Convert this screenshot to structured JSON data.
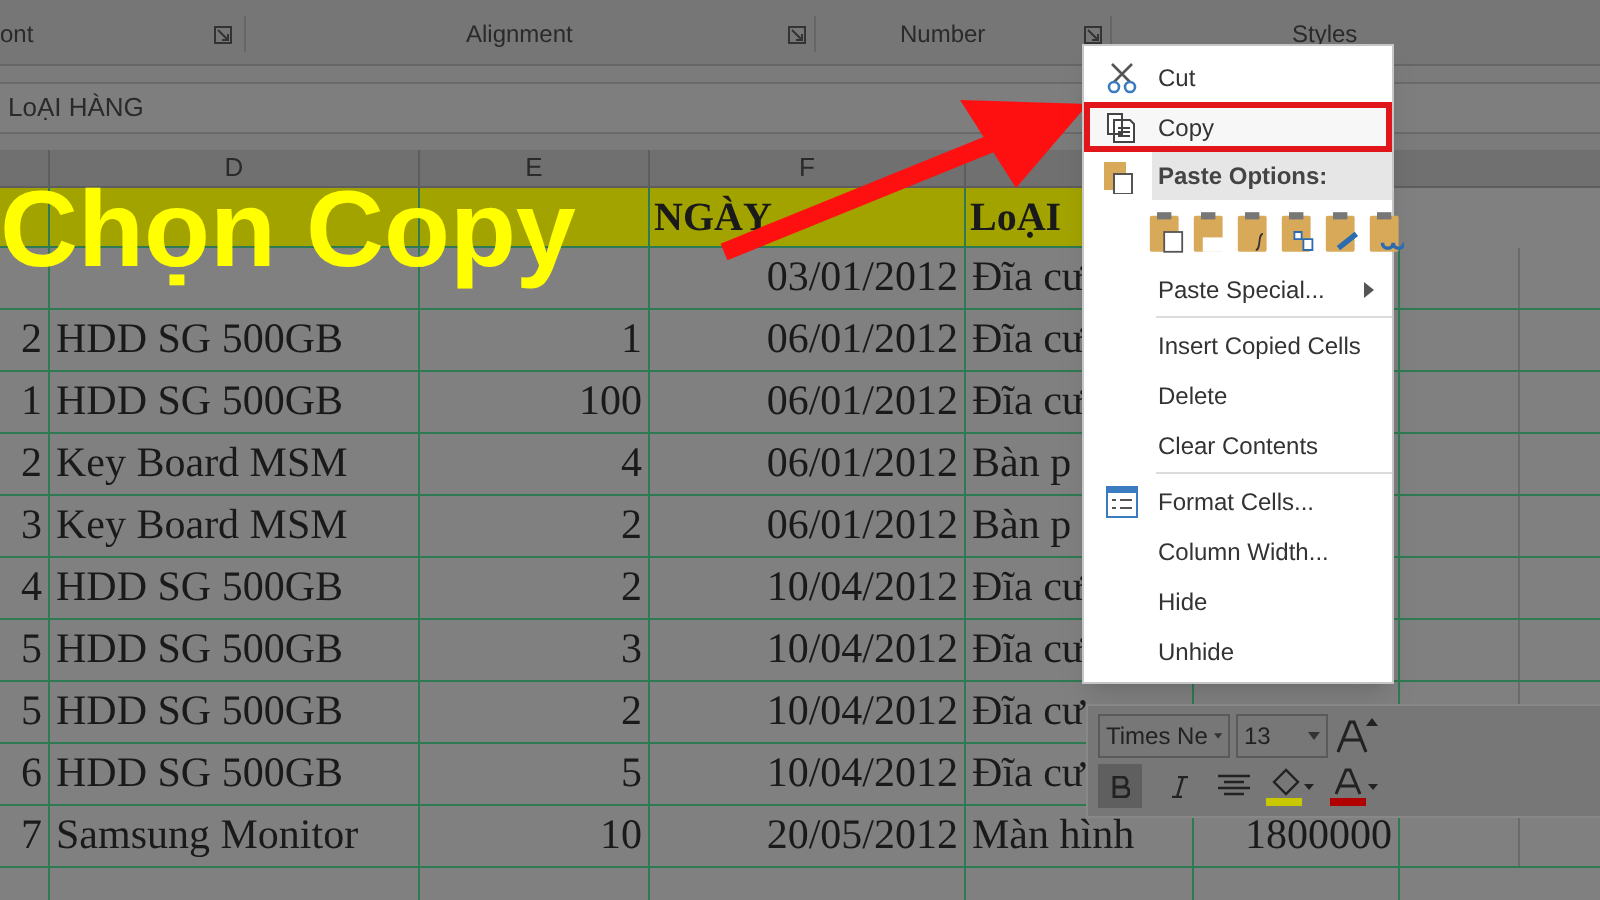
{
  "ribbon": {
    "groups": [
      {
        "label": "ont"
      },
      {
        "label": "Alignment"
      },
      {
        "label": "Number"
      },
      {
        "label": "Styles"
      }
    ]
  },
  "formula_bar": {
    "value": "LoẠI HÀNG"
  },
  "sheet": {
    "column_headers": [
      "D",
      "E",
      "F"
    ],
    "header_row": {
      "date": "NGÀY",
      "category": "LoẠI"
    },
    "rows": [
      {
        "date": "03/01/2012",
        "category": "Đĩa cư"
      },
      {
        "number": "2",
        "item": "HDD SG 500GB",
        "quantity": "1",
        "date": "06/01/2012",
        "category": "Đĩa cư"
      },
      {
        "number": "1",
        "item": "HDD SG 500GB",
        "quantity": "100",
        "date": "06/01/2012",
        "category": "Đĩa cư"
      },
      {
        "number": "2",
        "item": "Key Board MSM",
        "quantity": "4",
        "date": "06/01/2012",
        "category": "Bàn p"
      },
      {
        "number": "3",
        "item": "Key Board MSM",
        "quantity": "2",
        "date": "06/01/2012",
        "category": "Bàn p"
      },
      {
        "number": "4",
        "item": "HDD SG 500GB",
        "quantity": "2",
        "date": "10/04/2012",
        "category": "Đĩa cư"
      },
      {
        "number": "5",
        "item": "HDD SG 500GB",
        "quantity": "3",
        "date": "10/04/2012",
        "category": "Đĩa cư"
      },
      {
        "number": "5",
        "item": "HDD SG 500GB",
        "quantity": "2",
        "date": "10/04/2012",
        "category": "Đĩa cư"
      },
      {
        "number": "6",
        "item": "HDD SG 500GB",
        "quantity": "5",
        "date": "10/04/2012",
        "category": "Đĩa cư"
      },
      {
        "number": "7",
        "item": "Samsung Monitor",
        "quantity": "10",
        "date": "20/05/2012",
        "category": "Màn hình",
        "price": "1800000"
      }
    ]
  },
  "caption": "Chọn Copy",
  "context_menu": {
    "items": [
      {
        "kind": "command",
        "label": "Cut",
        "selected": false
      },
      {
        "kind": "command",
        "label": "Copy",
        "selected": true
      },
      {
        "kind": "header",
        "label": "Paste Options:"
      },
      {
        "kind": "paste_icons"
      },
      {
        "kind": "submenu",
        "label": "Paste Special...",
        "selected": false
      },
      {
        "kind": "command",
        "label": "Insert Copied Cells",
        "selected": false
      },
      {
        "kind": "command",
        "label": "Delete",
        "selected": false
      },
      {
        "kind": "command",
        "label": "Clear Contents",
        "selected": false
      },
      {
        "kind": "command",
        "label": "Format Cells...",
        "selected": false
      },
      {
        "kind": "command",
        "label": "Column Width...",
        "selected": false
      },
      {
        "kind": "command",
        "label": "Hide",
        "selected": false
      },
      {
        "kind": "command",
        "label": "Unhide",
        "selected": false
      }
    ]
  },
  "mini_toolbar": {
    "font_name": "Times Ne",
    "font_size": "13",
    "bold": true,
    "italic": false
  }
}
